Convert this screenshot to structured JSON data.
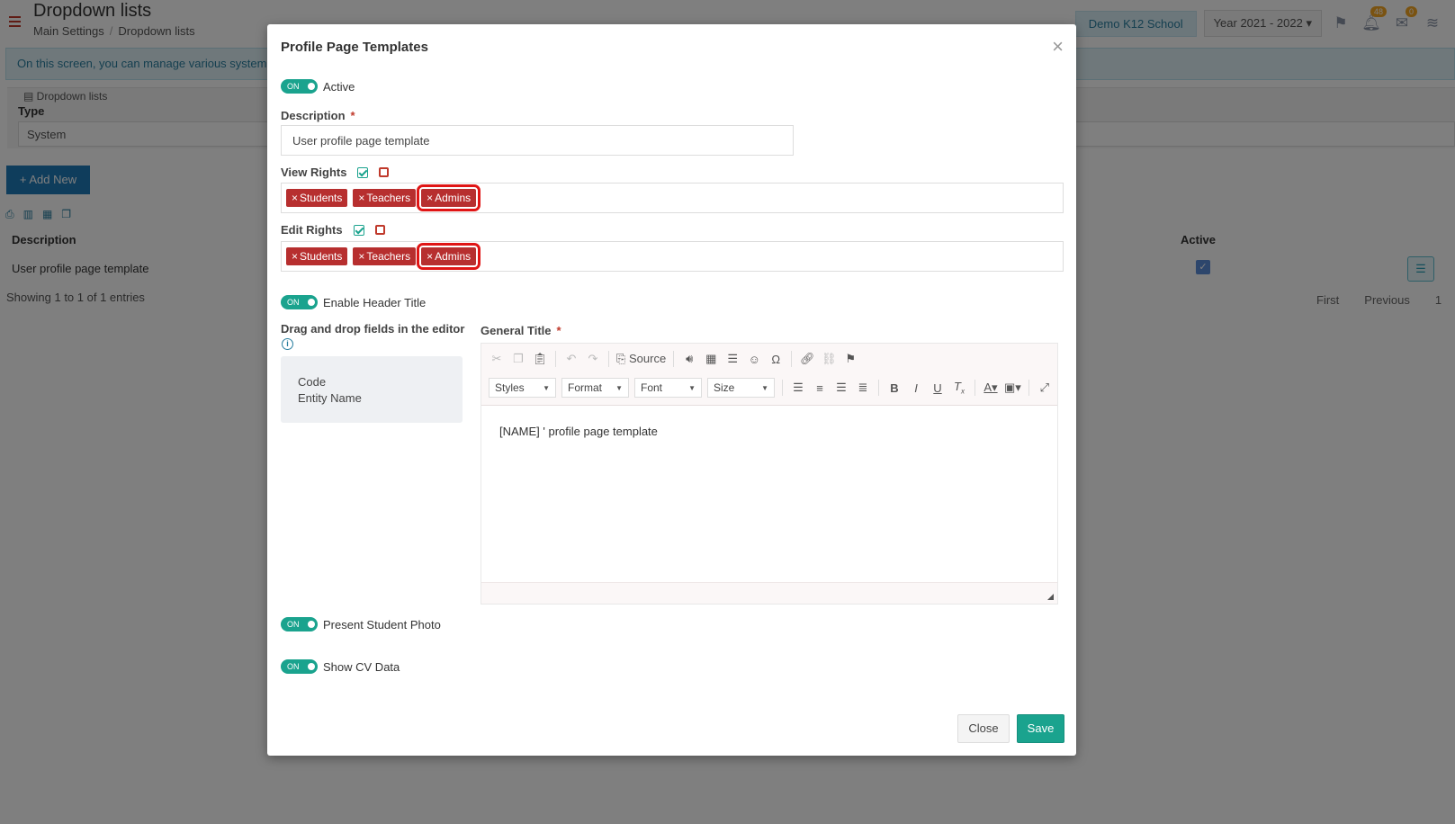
{
  "background": {
    "page_title": "Dropdown lists",
    "breadcrumb": [
      "Main Settings",
      "Dropdown lists"
    ],
    "info_text": "On this screen, you can manage various system",
    "school": "Demo K12 School",
    "year": "Year 2021 - 2022",
    "badges": {
      "notifications": "48",
      "messages": "0"
    },
    "filter": {
      "legend": "Dropdown lists",
      "type_label": "Type",
      "type_value": "System"
    },
    "add_new_label": "Add New",
    "table": {
      "col_description": "Description",
      "col_active": "Active",
      "row_description": "User profile page template"
    },
    "showing": "Showing 1 to 1 of 1 entries",
    "pager": [
      "First",
      "Previous",
      "1"
    ]
  },
  "modal": {
    "title": "Profile Page Templates",
    "active_toggle": {
      "state": "ON",
      "label": "Active"
    },
    "description": {
      "label": "Description",
      "value": "User profile page template"
    },
    "view_rights": {
      "label": "View Rights",
      "tags": [
        "Students",
        "Teachers",
        "Admins"
      ]
    },
    "edit_rights": {
      "label": "Edit Rights",
      "tags": [
        "Students",
        "Teachers",
        "Admins"
      ]
    },
    "header_toggle": {
      "state": "ON",
      "label": "Enable Header Title"
    },
    "drag_label": "Drag and drop fields in the editor",
    "fields": [
      "Code",
      "Entity Name"
    ],
    "general_title": {
      "label": "General Title"
    },
    "editor": {
      "source_label": "Source",
      "styles_label": "Styles",
      "format_label": "Format",
      "font_label": "Font",
      "size_label": "Size",
      "content": "[NAME] ' profile page template"
    },
    "photo_toggle": {
      "state": "ON",
      "label": "Present Student Photo"
    },
    "cv_toggle": {
      "state": "ON",
      "label": "Show CV Data"
    },
    "close_label": "Close",
    "save_label": "Save"
  },
  "colors": {
    "accent": "#1aa38e",
    "tag": "#b72f2f",
    "highlight": "#e01515",
    "primary_button": "#1f7ab8"
  }
}
